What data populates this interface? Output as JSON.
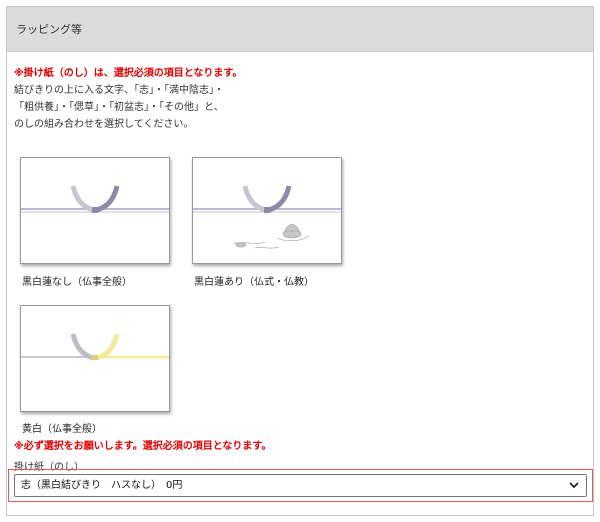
{
  "section": {
    "title": "ラッピング等"
  },
  "notice_top": "※掛け紙（のし）は、選択必須の項目となります。",
  "description": [
    "結びきりの上に入る文字、「志」・「満中陰志」・",
    "「粗供養」・「偲草」・「初盆志」・「その他」と、",
    "のしの組み合わせを選択してください。"
  ],
  "options": [
    {
      "label": "黒白蓮なし（仏事全般）",
      "style": "black-white-plain",
      "ribbon_color": "#a5a3bd",
      "accent_color": "#8c8aa8"
    },
    {
      "label": "黒白蓮あり（仏式・仏教）",
      "style": "black-white-lotus",
      "ribbon_color": "#a5a3bd",
      "accent_color": "#8c8aa8"
    },
    {
      "label": "黄白（仏事全般）",
      "style": "yellow-white",
      "ribbon_color": "#f2ec9a",
      "accent_color": "#b9b9c0"
    }
  ],
  "notice_bottom": "※必ず選択をお願いします。選択必須の項目となります。",
  "field": {
    "label": "掛け紙（のし）",
    "selected": "志（黒白結びきり　ハスなし）　0円",
    "highlight_color": "#e05a5a"
  },
  "colors": {
    "notice": "#e00000",
    "header_bg": "#dcdcdc"
  }
}
